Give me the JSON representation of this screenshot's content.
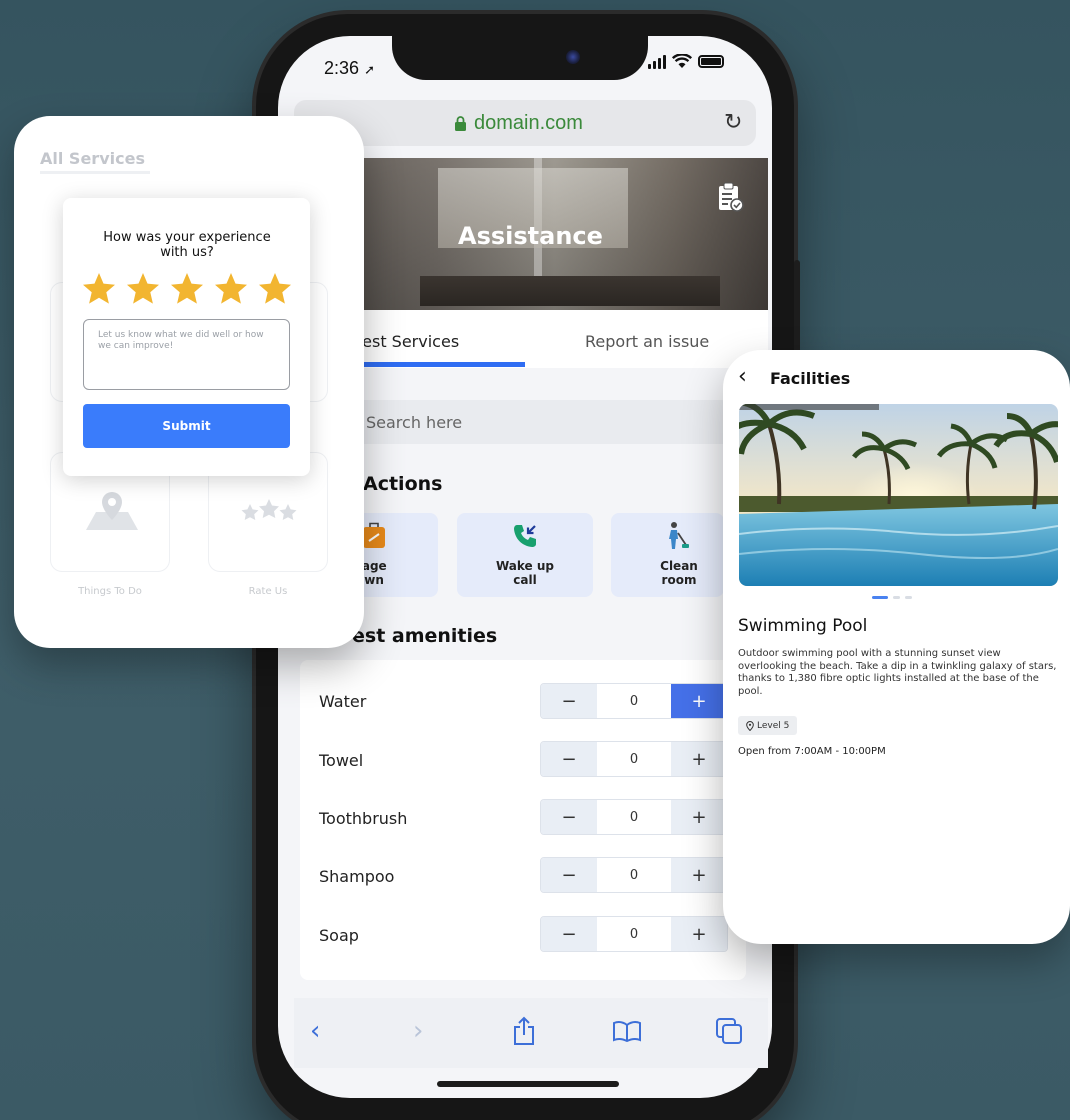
{
  "status_bar": {
    "time": "2:36"
  },
  "browser": {
    "url": "domain.com"
  },
  "hero": {
    "title": "Assistance"
  },
  "tabs": [
    {
      "label": "Request Services",
      "visible": "uest Services",
      "active": true
    },
    {
      "label": "Report an issue",
      "active": false
    }
  ],
  "search": {
    "placeholder": "Search here"
  },
  "quick_actions": {
    "title": "Actions",
    "items": [
      {
        "label": "gage\nown",
        "icon": "luggage-icon"
      },
      {
        "label": "Wake up\ncall",
        "icon": "phone-callback-icon"
      },
      {
        "label": "Clean\nroom",
        "icon": "cleaning-icon"
      }
    ]
  },
  "amenities": {
    "title": "est amenities",
    "items": [
      {
        "name": "Water",
        "qty": "0",
        "plus_active": true
      },
      {
        "name": "Towel",
        "qty": "0",
        "plus_active": false
      },
      {
        "name": "Toothbrush",
        "qty": "0",
        "plus_active": false
      },
      {
        "name": "Shampoo",
        "qty": "0",
        "plus_active": false
      },
      {
        "name": "Soap",
        "qty": "0",
        "plus_active": false
      }
    ]
  },
  "left_card": {
    "title": "All Services",
    "ghost_tiles": [
      {
        "label": "Things To Do"
      },
      {
        "label": "Rate Us"
      }
    ],
    "rating": {
      "question": "How was your experience with us?",
      "stars": 5,
      "max_stars": 5,
      "feedback_placeholder": "Let us know what we did well or how we  can improve!",
      "submit_label": "Submit"
    }
  },
  "facility_card": {
    "title": "Facilities",
    "name": "Swimming Pool",
    "description": "Outdoor swimming pool with a stunning sunset view overlooking the beach. Take a dip in a twinkling galaxy of stars, thanks to 1,380 fibre optic lights installed at the base of the pool.",
    "level": "Level 5",
    "hours": "Open from 7:00AM - 10:00PM",
    "carousel_page": 1,
    "carousel_total": 3
  },
  "colors": {
    "accent": "#3a7cfb",
    "star": "#f2b530",
    "qa_card": "#e5ebfa",
    "background": "#3b5a65"
  }
}
